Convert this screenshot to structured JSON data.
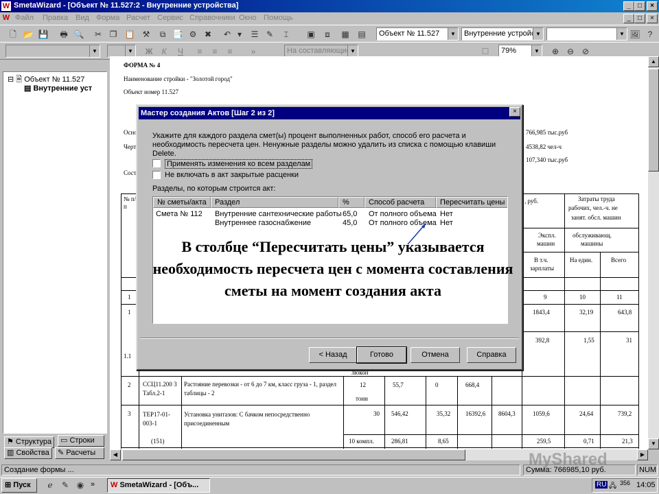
{
  "window": {
    "app_logo": "W",
    "title": "SmetaWizard - [Объект № 11.527:2 - Внутренние устройства]"
  },
  "menu": [
    "Файл",
    "Правка",
    "Вид",
    "Форма",
    "Расчет",
    "Сервис",
    "Справочники",
    "Окно",
    "Помощь"
  ],
  "toolbar1": {
    "object_combo": "Объект № 11.527",
    "section_combo": "Внутренние устройст",
    "empty_combo": ""
  },
  "toolbar2": {
    "font_combo": "",
    "size_combo": "",
    "bold": "Ж",
    "italic": "К",
    "underline": "Ч",
    "placement_combo": "На составляющие",
    "zoom_combo": "79%"
  },
  "tree": {
    "root": "Объект № 11.527",
    "child": "Внутренние уст",
    "tabs": [
      "Структура",
      "Строки",
      "Свойства",
      "Расчеты"
    ]
  },
  "document": {
    "form": "ФОРМА № 4",
    "site": "Наименование стройки - \"Золотой город\"",
    "object": "Объект номер 11.527",
    "left_labels": [
      "Осно",
      "Черт",
      "Сост"
    ],
    "right_values": [
      "766,985 тыс.руб",
      "4538,82 чел-ч",
      "107,340 тыс.руб"
    ],
    "header_right": [
      ", руб.",
      "Затраты труда",
      "рабочих, чел.-ч. не",
      "занят. обсл. машин",
      "Экспл.",
      "машин",
      "обслуживающ.",
      "машины",
      "В т.ч.",
      "зарплаты",
      "На един.",
      "Всего"
    ],
    "col_nums": [
      "9",
      "10",
      "11"
    ],
    "rows": [
      {
        "n": "№ п/п"
      },
      {
        "n": "1"
      },
      {
        "n": "1",
        "a": "1843,4",
        "b": "32,19",
        "c": "643,8",
        "d": "392,8",
        "e": "1,55",
        "f": "31"
      },
      {
        "n": "1.1",
        "note": "люкон"
      },
      {
        "n": "2",
        "code": "ССЦ11.200 3 Табл.2-1",
        "desc": "Растояние перевозки - от 6 до 7 км, класс груза - 1, раздел таблицы - 2",
        "qty": "12",
        "unit": "тонн",
        "v1": "55,7",
        "v2": "0",
        "v3": "668,4"
      },
      {
        "n": "3",
        "code": "ТЕР17-01-003-1",
        "desc": "Установка унитазов: С бачком непосредственно присоединенным",
        "qty": "30",
        "v1": "546,42",
        "v2": "35,32",
        "v3": "16392,6",
        "v4": "8604,3",
        "v5": "1059,6",
        "v6": "24,64",
        "v7": "739,2"
      },
      {
        "code": "(151)",
        "qty": "10 компл.",
        "v1": "286,81",
        "v2": "8,65",
        "v5": "259,5",
        "v6": "0,71",
        "v7": "21,3"
      }
    ]
  },
  "dialog": {
    "title": "Мастер создания Актов [Шаг 2 из 2]",
    "instructions": "Укажите для каждого раздела смет(ы) процент выполненных работ, способ его расчета и необходимость пересчета цен. Ненужные разделы можно удалить из списка с помощью клавиши Delete.",
    "check_apply_all": "Применять изменения ко всем разделам",
    "check_exclude_closed": "Не включать в акт закрытые расценки",
    "list_label": "Разделы, по которым строится акт:",
    "columns": [
      "№ сметы/акта",
      "Раздел",
      "%",
      "Способ расчета",
      "Пересчитать цены"
    ],
    "rows": [
      {
        "estimate": "Смета № 112",
        "section": "Внутренние сантехнические работы",
        "percent": "65,0",
        "method": "От полного объема",
        "recalc": "Нет"
      },
      {
        "estimate": "",
        "section": "Внутреннее газоснабжение",
        "percent": "45,0",
        "method": "От полного объема",
        "recalc": "Нет"
      }
    ],
    "annotation": "В столбце “Пересчитать цены” указывается необходимость пересчета цен с момента составления сметы на момент создания акта",
    "buttons": {
      "back": "< Назад",
      "done": "Готово",
      "cancel": "Отмена",
      "help": "Справка"
    }
  },
  "status": {
    "left": "Создание формы ...",
    "sum": "Сумма: 766985,10 руб.",
    "num": "NUM",
    "watermark": "MyShared"
  },
  "taskbar": {
    "start": "Пуск",
    "task": "SmetaWizard - [Объ...",
    "lang": "RU",
    "tray_num": "356",
    "time": "14:05"
  }
}
